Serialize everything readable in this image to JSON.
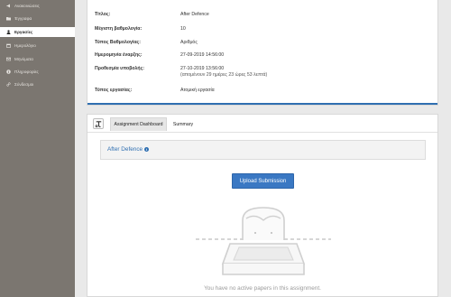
{
  "sidebar": {
    "items": [
      {
        "label": "Ανακοινώσεις",
        "icon": "megaphone-icon",
        "active": false
      },
      {
        "label": "Έγγραφα",
        "icon": "folder-icon",
        "active": false
      },
      {
        "label": "Εργασίες",
        "icon": "user-icon",
        "active": true
      },
      {
        "label": "Ημερολόγιο",
        "icon": "calendar-icon",
        "active": false
      },
      {
        "label": "Μηνύματα",
        "icon": "envelope-icon",
        "active": false
      },
      {
        "label": "Πληροφορίες",
        "icon": "info-icon",
        "active": false
      },
      {
        "label": "Σύνδεσμοι",
        "icon": "link-icon",
        "active": false
      }
    ]
  },
  "assignment_info": {
    "rows": [
      {
        "label": "Τίτλος:",
        "value": "After Defence"
      },
      {
        "label": "Μέγιστη βαθμολογία:",
        "value": "10"
      },
      {
        "label": "Τύπος Βαθμολογίας:",
        "value": "Αριθμός"
      },
      {
        "label": "Ημερομηνία έναρξης:",
        "value": "27-09-2019 14:56:00"
      },
      {
        "label": "Προθεσμία υποβολής:",
        "value": "27-10-2019 13:56:00",
        "sub": "(απομένουν 29 ημέρες 23 ώρες 53 λεπτά)"
      },
      {
        "label": "Τύπος εργασίας:",
        "value": "Ατομική εργασία"
      }
    ]
  },
  "dashboard": {
    "tabs": [
      "Assignment Dashboard",
      "Summary"
    ],
    "assignment_title": "After Defence",
    "upload_label": "Upload Submission",
    "empty_message": "You have no active papers in this assignment."
  },
  "colors": {
    "sidebar_bg": "#7b7670",
    "accent": "#2f6fb1",
    "button": "#3a78c3"
  }
}
